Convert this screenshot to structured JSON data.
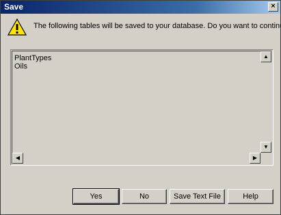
{
  "window": {
    "title": "Save",
    "close_glyph": "×"
  },
  "message": "The following tables will be saved to your database. Do you want to continue?",
  "list": {
    "items": [
      "PlantTypes",
      "Oils"
    ]
  },
  "scrollbar": {
    "up": "▲",
    "down": "▼",
    "left": "◀",
    "right": "▶"
  },
  "buttons": {
    "yes": "Yes",
    "no": "No",
    "save_text_file": "Save Text File",
    "help": "Help"
  },
  "icons": {
    "warning": "warning-icon"
  }
}
